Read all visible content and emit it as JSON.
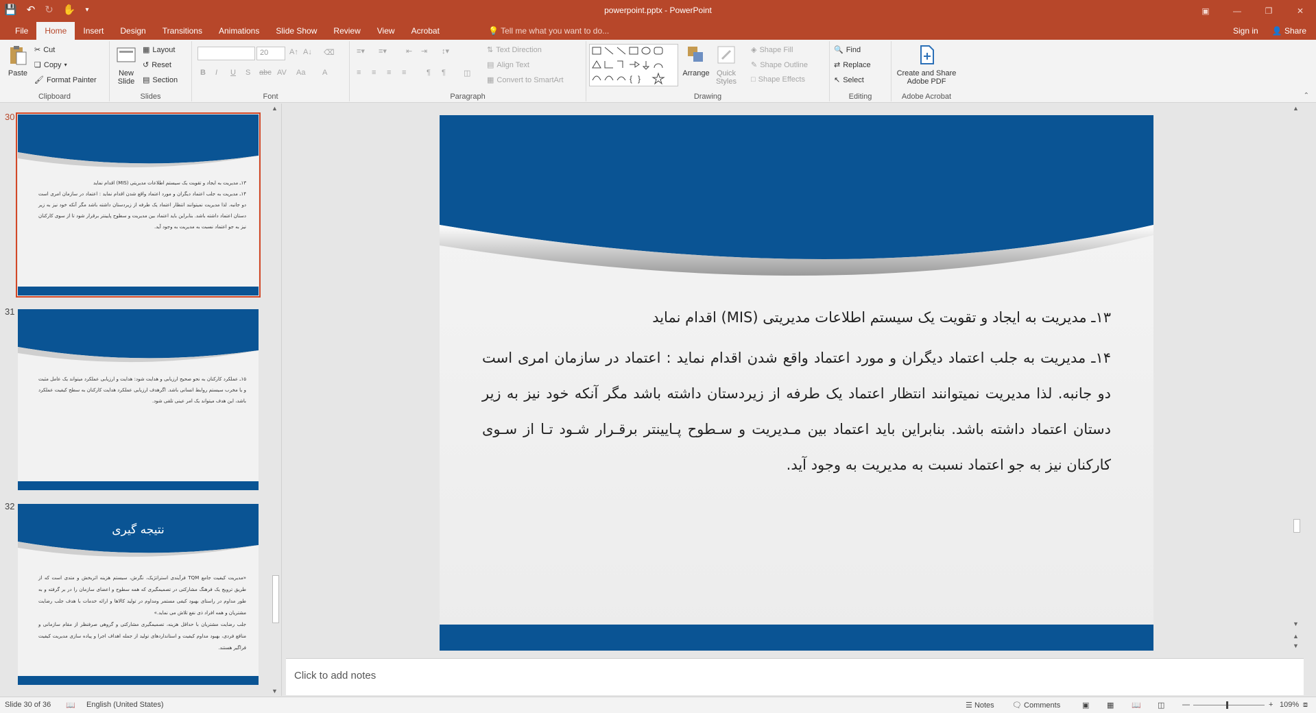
{
  "window": {
    "title": "powerpoint.pptx - PowerPoint",
    "qat_icons": [
      "save-icon",
      "undo-icon",
      "redo-icon",
      "touch-mode-icon",
      "customize-icon"
    ]
  },
  "tabs": [
    {
      "label": "File"
    },
    {
      "label": "Home"
    },
    {
      "label": "Insert"
    },
    {
      "label": "Design"
    },
    {
      "label": "Transitions"
    },
    {
      "label": "Animations"
    },
    {
      "label": "Slide Show"
    },
    {
      "label": "Review"
    },
    {
      "label": "View"
    },
    {
      "label": "Acrobat"
    }
  ],
  "active_tab": "Home",
  "tell_me": "Tell me what you want to do...",
  "sign_in": "Sign in",
  "share": "Share",
  "ribbon": {
    "clipboard": {
      "label": "Clipboard",
      "paste": "Paste",
      "cut": "Cut",
      "copy": "Copy",
      "format_painter": "Format Painter"
    },
    "slides": {
      "label": "Slides",
      "new_slide": "New",
      "new_slide_2": "Slide",
      "layout": "Layout",
      "reset": "Reset",
      "section": "Section"
    },
    "font": {
      "label": "Font",
      "size": "20",
      "bold": "B",
      "italic": "I",
      "underline": "U",
      "shadow": "S",
      "strike": "abc",
      "spacing": "AV",
      "case": "Aa",
      "color": "A"
    },
    "paragraph": {
      "label": "Paragraph",
      "text_direction": "Text Direction",
      "align_text": "Align Text",
      "smartart": "Convert to SmartArt"
    },
    "drawing": {
      "label": "Drawing",
      "arrange": "Arrange",
      "quick_styles": "Quick",
      "quick_styles_2": "Styles",
      "shape_fill": "Shape Fill",
      "shape_outline": "Shape Outline",
      "shape_effects": "Shape Effects"
    },
    "editing": {
      "label": "Editing",
      "find": "Find",
      "replace": "Replace",
      "select": "Select"
    },
    "acrobat": {
      "label": "Adobe Acrobat",
      "create": "Create and Share",
      "create_2": "Adobe PDF"
    }
  },
  "thumbnails": [
    {
      "number": "30",
      "selected": true,
      "title": "",
      "paragraphs": [
        "۱۳ـ مدیریت به ایجاد و تقویت یک سیستم اطلاعات مدیریتی (MIS) اقدام نماید",
        "۱۴ـ مدیریت به جلب اعتماد دیگران و مورد اعتماد واقع شدن اقدام نماید : اعتماد در سازمان امری است دو جانبه. لذا مدیریت نمیتوانند انتظار اعتماد یک طرفه از زیردستان داشته باشد مگر آنکه خود نیز به زیر دستان اعتماد داشته باشد. بنابراین باید اعتماد بین مدیریت و سطوح پایینتر برقرار شود تا از سوی کارکنان نیز به جو اعتماد نسبت به مدیریت به وجود آید."
      ]
    },
    {
      "number": "31",
      "selected": false,
      "title": "",
      "paragraphs": [
        "۱۵ـ عملکرد کارکنان به نحو صحیح ارزیابی و هدایت شود: هدایت و ارزیابی عملکرد میتواند یک عامل مثبت و یا مخرب سیستم روابط انسانی باشد. اگرهدف ارزیابی عملکرد هدایت کارکنان به سطح کیفیت عملکرد باشد، این هدف میتواند یک امر عینی تلقی شود."
      ]
    },
    {
      "number": "32",
      "selected": false,
      "title": "نتیجه گیری",
      "paragraphs": [
        "«مدیریت کیفیت جامع TQM فرآیندی استراتژیک، نگرش، سیستم هزینه اثربخش و متدی است که از طریق ترویج یک فرهنگ مشارکتی در تصمیمگیری که همه سطوح و اعضای سازمان را در بر گرفته و به طور مداوم در راستای بهبود کیفی مستمر ومداوم در تولید کالاها و ارائه خدمات با هدف جلب رضایت مشتریان و همه افراد ذی نفع تلاش می نماید.»",
        "جلب رضایت مشتریان با حداقل هزینه، تصمیمگیری مشارکتی و گروهی صرفنظر از مقام سازمانی و منافع فردی، بهبود مداوم کیفیت و استانداردهای تولید از جمله اهداف اجرا و پیاده سازی مدیریت کیفیت فراگیر هستند."
      ]
    }
  ],
  "slide": {
    "paragraphs": [
      "۱۳ـ مدیریت به ایجاد و تقویت یک سیستم اطلاعات مدیریتی (MIS) اقدام نماید",
      "۱۴ـ مدیریت به جلب اعتماد دیگران و مورد اعتماد واقع شدن اقدام نماید : اعتماد در سازمان امری است دو جانبه. لذا مدیریت نمیتوانند انتظار اعتماد یک طرفه از زیردستان داشته باشد مگر آنکه خود نیز به زیر دستان اعتماد داشته باشد. بنابراین باید اعتماد بین مـدیریت و سـطوح پـایینتر برقـرار شـود تـا از سـوی کارکنان نیز به جو اعتماد نسبت به مدیریت به وجود آید."
    ]
  },
  "notes_placeholder": "Click to add notes",
  "status": {
    "slide_counter": "Slide 30 of 36",
    "language": "English (United States)",
    "notes": "Notes",
    "comments": "Comments",
    "zoom": "109%"
  },
  "colors": {
    "accent": "#b7472a",
    "slide_blue": "#0a5494",
    "selection": "#d24726"
  }
}
